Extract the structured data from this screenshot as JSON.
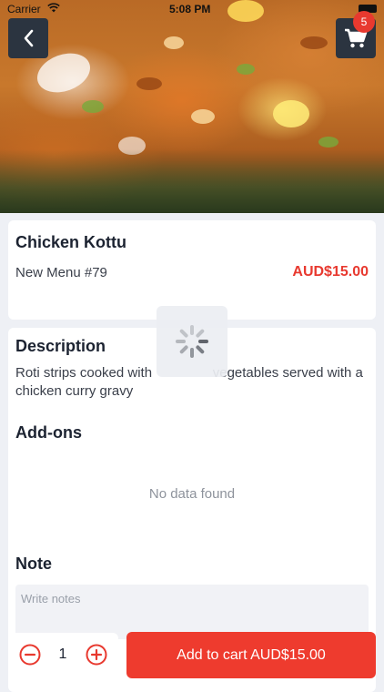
{
  "status_bar": {
    "carrier": "Carrier",
    "time": "5:08 PM"
  },
  "header": {
    "back_icon": "chevron-left-icon",
    "cart_icon": "shopping-cart-icon",
    "cart_count": "5"
  },
  "item": {
    "name": "Chicken Kottu",
    "subtitle": "New Menu #79",
    "price": "AUD$15.00"
  },
  "description": {
    "heading": "Description",
    "text": "Roti strips cooked with                vegetables served with a chicken curry gravy"
  },
  "addons": {
    "heading": "Add-ons",
    "empty_text": "No data found"
  },
  "note": {
    "heading": "Note",
    "placeholder": "Write notes",
    "value": ""
  },
  "cart": {
    "quantity": "1",
    "minus_icon": "minus-circle-icon",
    "plus_icon": "plus-circle-icon",
    "add_label": "Add to cart AUD$15.00"
  },
  "colors": {
    "accent": "#ee3b2e",
    "price": "#e8392f",
    "overlay_button": "#2b3440",
    "background": "#eef0f5"
  }
}
